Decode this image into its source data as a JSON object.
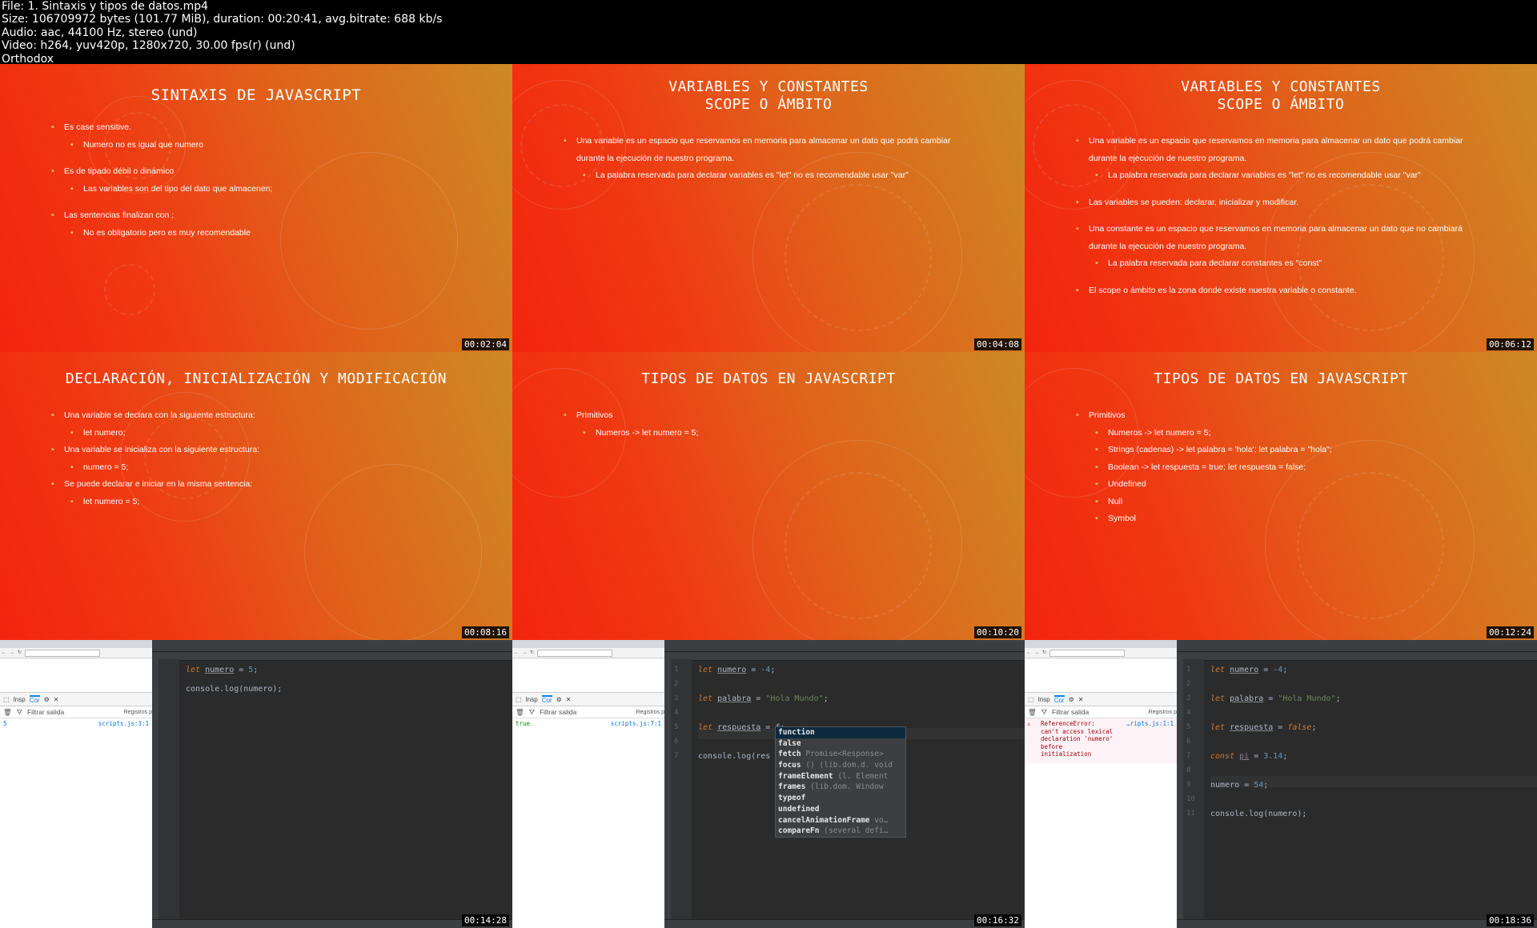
{
  "header": {
    "file": "File: 1. Sintaxis y tipos de datos.mp4",
    "size": "Size: 106709972 bytes (101.77 MiB), duration: 00:20:41, avg.bitrate: 688 kb/s",
    "audio": "Audio: aac, 44100 Hz, stereo (und)",
    "video": "Video: h264, yuv420p, 1280x720, 30.00 fps(r) (und)",
    "author": "Orthodox"
  },
  "slides": [
    {
      "title": "SINTAXIS DE JAVASCRIPT",
      "timestamp": "00:02:04",
      "bullets": [
        {
          "level": 1,
          "text": "Es case sensitive."
        },
        {
          "level": 2,
          "text": "Numero no es igual que numero"
        },
        {
          "gap": true
        },
        {
          "level": 1,
          "text": "Es de tipado débil o dinámico"
        },
        {
          "level": 2,
          "text": "Las variables son del tipo del dato que almacenen;"
        },
        {
          "gap": true
        },
        {
          "level": 1,
          "text": "Las sentencias finalizan con ;"
        },
        {
          "level": 2,
          "text": "No es obligatorio pero es muy recomendable"
        }
      ]
    },
    {
      "title": "VARIABLES Y CONSTANTES",
      "title2": "SCOPE O ÁMBITO",
      "timestamp": "00:04:08",
      "bullets": [
        {
          "level": 1,
          "text": "Una variable es un espacio que reservamos en memoria para almacenar un dato que podrá cambiar"
        },
        {
          "level": 0,
          "text": "durante la ejecución de nuestro programa."
        },
        {
          "level": 2,
          "text": "La palabra reservada para declarar variables es \"let\" no es recomendable usar \"var\""
        }
      ]
    },
    {
      "title": "VARIABLES Y CONSTANTES",
      "title2": "SCOPE O ÁMBITO",
      "timestamp": "00:06:12",
      "bullets": [
        {
          "level": 1,
          "text": "Una variable es un espacio que reservamos en memoria para almacenar un dato que podrá cambiar"
        },
        {
          "level": 0,
          "text": "durante la ejecución de nuestro programa."
        },
        {
          "level": 2,
          "text": "La palabra reservada para declarar variables es \"let\" no es recomendable usar \"var\""
        },
        {
          "gap": true
        },
        {
          "level": 1,
          "text": "Las variables se pueden: declarar, inicializar y modificar."
        },
        {
          "gap": true
        },
        {
          "level": 1,
          "text": "Una constante es un espacio que reservamos en memoria para almacenar un dato que no cambiará"
        },
        {
          "level": 0,
          "text": "durante la ejecución de nuestro programa."
        },
        {
          "level": 2,
          "text": "La palabra reservada para declarar constantes es \"const\""
        },
        {
          "gap": true
        },
        {
          "level": 1,
          "text": "El scope o ámbito es la zona donde existe nuestra variable o constante."
        }
      ]
    },
    {
      "title": "DECLARACIÓN, INICIALIZACIÓN Y MODIFICACIÓN",
      "timestamp": "00:08:16",
      "bullets": [
        {
          "level": 1,
          "text": "Una variable se declara con la siguiente estructura:"
        },
        {
          "level": 2,
          "text": "let numero;"
        },
        {
          "level": 1,
          "text": "Una variable se inicializa con la siguiente estructura:"
        },
        {
          "level": 2,
          "text": "numero = 5;"
        },
        {
          "level": 1,
          "text": "Se puede declarar e iniciar en la misma sentencia:"
        },
        {
          "level": 2,
          "text": "let numero = 5;"
        }
      ]
    },
    {
      "title": "TIPOS DE DATOS EN JAVASCRIPT",
      "timestamp": "00:10:20",
      "bullets": [
        {
          "level": 1,
          "text": "Primitivos"
        },
        {
          "level": 2,
          "text": "Numeros -> let numero = 5;"
        }
      ]
    },
    {
      "title": "TIPOS DE DATOS EN JAVASCRIPT",
      "timestamp": "00:12:24",
      "bullets": [
        {
          "level": 1,
          "text": "Primitivos"
        },
        {
          "level": 2,
          "text": "Numeros -> let numero = 5;"
        },
        {
          "level": 2,
          "text": "Strings (cadenas) -> let palabra = 'hola'; let palabra = \"hola\";"
        },
        {
          "level": 2,
          "text": "Boolean -> let respuesta = true; let respuesta = false;"
        },
        {
          "level": 2,
          "text": "Undefined"
        },
        {
          "level": 2,
          "text": "Null"
        },
        {
          "level": 2,
          "text": "Symbol"
        }
      ]
    }
  ],
  "screens": [
    {
      "timestamp": "00:14:28",
      "devtools": {
        "inspector": "Insp",
        "console_tab": "Cor",
        "filter": "Filtrar salida",
        "logs": "Registros p"
      },
      "console_value": "5",
      "console_source": "scripts.js:3:1"
    },
    {
      "timestamp": "00:16:32",
      "devtools": {
        "inspector": "Insp",
        "console_tab": "Cor",
        "filter": "Filtrar salida",
        "logs": "Registros p"
      },
      "console_value": "true",
      "console_source": "scripts.js:7:1",
      "autocomplete": [
        {
          "name": "function",
          "hint": ""
        },
        {
          "name": "false",
          "hint": ""
        },
        {
          "name": "fetch",
          "hint": "Promise<Response>"
        },
        {
          "name": "focus",
          "hint": "() (lib.dom.d. void"
        },
        {
          "name": "frameElement",
          "hint": "(l. Element"
        },
        {
          "name": "frames",
          "hint": "(lib.dom. Window"
        },
        {
          "name": "typeof",
          "hint": ""
        },
        {
          "name": "undefined",
          "hint": ""
        },
        {
          "name": "cancelAnimationFrame",
          "hint": "vo…"
        },
        {
          "name": "compareFn",
          "hint": "(several defi…"
        }
      ]
    },
    {
      "timestamp": "00:18:36",
      "devtools": {
        "inspector": "Insp",
        "console_tab": "Cor",
        "filter": "Filtrar salida",
        "logs": "Registros p"
      },
      "error_lines": [
        "ReferenceError:",
        "can't access lexical",
        "declaration 'numero'",
        "before",
        "initialization"
      ],
      "console_source": "…ripts.js:1:1"
    }
  ],
  "code": {
    "s1": {
      "l1_kw": "let",
      "l1_var": "numero",
      "l1_rest": " = ",
      "l1_num": "5",
      "l1_end": ";",
      "l3": "console.log(numero);"
    },
    "s2": {
      "l1_kw": "let",
      "l1_var": "numero",
      "l1_num": "-4",
      "l3_kw": "let",
      "l3_var": "palabra",
      "l3_str": "\"Hola Mundo\"",
      "l5_kw": "let",
      "l5_var": "respuesta",
      "l5_typed": "f",
      "l7": "console.log(res"
    },
    "s3": {
      "l1_kw": "let",
      "l1_var": "numero",
      "l1_num": "-4",
      "l3_kw": "let",
      "l3_var": "palabra",
      "l3_str": "\"Hola Mundo\"",
      "l5_kw": "let",
      "l5_var": "respuesta",
      "l5_val": "false",
      "l7_kw": "const",
      "l7_var": "pi",
      "l7_num": "3.14",
      "l9_a": "numero = ",
      "l9_num": "54",
      "l11": "console.log(numero);"
    }
  },
  "line_numbers": {
    "s2": [
      "1",
      "2",
      "3",
      "4",
      "5",
      "6",
      "7"
    ],
    "s3": [
      "1",
      "2",
      "3",
      "4",
      "5",
      "6",
      "7",
      "8",
      "9",
      "10",
      "11"
    ]
  },
  "colors": {
    "slide_red": "#f3240e",
    "slide_orange": "#cc8a24",
    "editor_bg": "#2b2b2b",
    "keyword": "#cc7832",
    "number": "#6897bb",
    "string": "#6a8759"
  }
}
